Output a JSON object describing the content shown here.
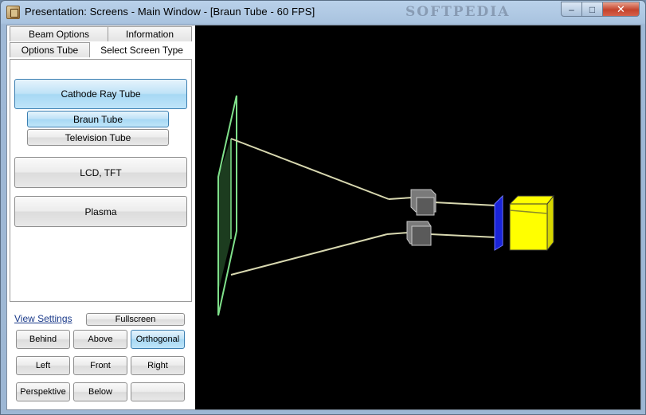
{
  "window": {
    "title": "Presentation: Screens - Main Window - [Braun Tube - 60 FPS]",
    "watermark": "SOFTPEDIA",
    "minimize_glyph": "–",
    "maximize_glyph": "□",
    "close_glyph": "✕"
  },
  "tabs": {
    "row_back": [
      {
        "label": "Beam Options"
      },
      {
        "label": "Information"
      }
    ],
    "row_front": [
      {
        "label": "Options Tube"
      },
      {
        "label": "Select Screen Type",
        "active": true
      }
    ]
  },
  "screen_types": {
    "cathode": "Cathode Ray Tube",
    "braun": "Braun Tube",
    "television": "Television Tube",
    "lcd": "LCD, TFT",
    "plasma": "Plasma",
    "selected": [
      "Cathode Ray Tube",
      "Braun Tube"
    ]
  },
  "view_settings": {
    "label": "View Settings",
    "fullscreen": "Fullscreen",
    "buttons": [
      {
        "label": "Behind"
      },
      {
        "label": "Above"
      },
      {
        "label": "Orthogonal",
        "selected": true
      },
      {
        "label": "Left"
      },
      {
        "label": "Front"
      },
      {
        "label": "Right"
      },
      {
        "label": "Perspektive"
      },
      {
        "label": "Below"
      },
      {
        "label": ""
      }
    ]
  },
  "scene": {
    "background": "#000000",
    "screen_color": "#7fe08a",
    "beam_color": "#d8d8b0",
    "deflector_color": "#7a7a7a",
    "grid_color": "#1a24d8",
    "cathode_color": "#ffff00"
  }
}
